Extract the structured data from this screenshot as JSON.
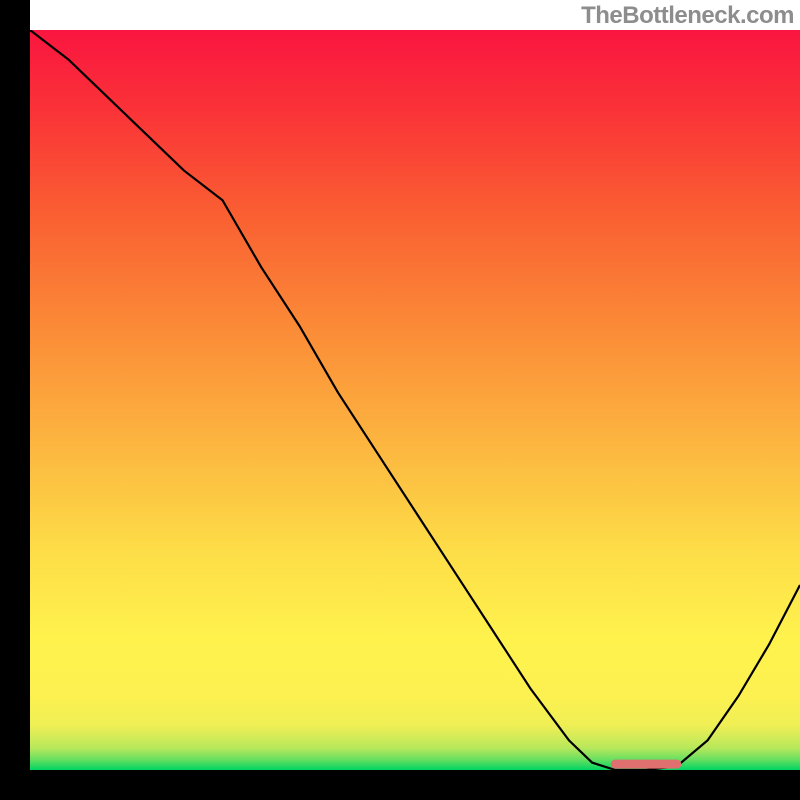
{
  "watermark": "TheBottleneck.com",
  "chart_data": {
    "type": "line",
    "title": "",
    "xlabel": "",
    "ylabel": "",
    "xlim": [
      0,
      100
    ],
    "ylim": [
      0,
      100
    ],
    "grid": false,
    "background_gradient": {
      "stops": [
        {
          "offset": 0.0,
          "color": "#00d562"
        },
        {
          "offset": 0.015,
          "color": "#6de060"
        },
        {
          "offset": 0.03,
          "color": "#b8e85b"
        },
        {
          "offset": 0.06,
          "color": "#efef55"
        },
        {
          "offset": 0.1,
          "color": "#fcf150"
        },
        {
          "offset": 0.18,
          "color": "#fff24d"
        },
        {
          "offset": 0.3,
          "color": "#fddc47"
        },
        {
          "offset": 0.45,
          "color": "#fcb33f"
        },
        {
          "offset": 0.6,
          "color": "#fb8a37"
        },
        {
          "offset": 0.75,
          "color": "#fa5f32"
        },
        {
          "offset": 0.9,
          "color": "#fa3038"
        },
        {
          "offset": 1.0,
          "color": "#fa1540"
        }
      ]
    },
    "series": [
      {
        "name": "bottleneck-curve",
        "color": "#000000",
        "x": [
          0,
          5,
          10,
          15,
          20,
          25,
          30,
          35,
          40,
          45,
          50,
          55,
          60,
          65,
          70,
          73,
          76,
          80,
          84,
          88,
          92,
          96,
          100
        ],
        "y": [
          100,
          96,
          91,
          86,
          81,
          77,
          68,
          60,
          51,
          43,
          35,
          27,
          19,
          11,
          4,
          1,
          0,
          0,
          0.5,
          4,
          10,
          17,
          25
        ]
      }
    ],
    "marker": {
      "name": "target-segment",
      "color": "#e07070",
      "linewidth": 9,
      "x": [
        76,
        84
      ],
      "y": [
        0.8,
        0.8
      ]
    },
    "axis_color": "#000000",
    "axis_linewidth": 12
  }
}
